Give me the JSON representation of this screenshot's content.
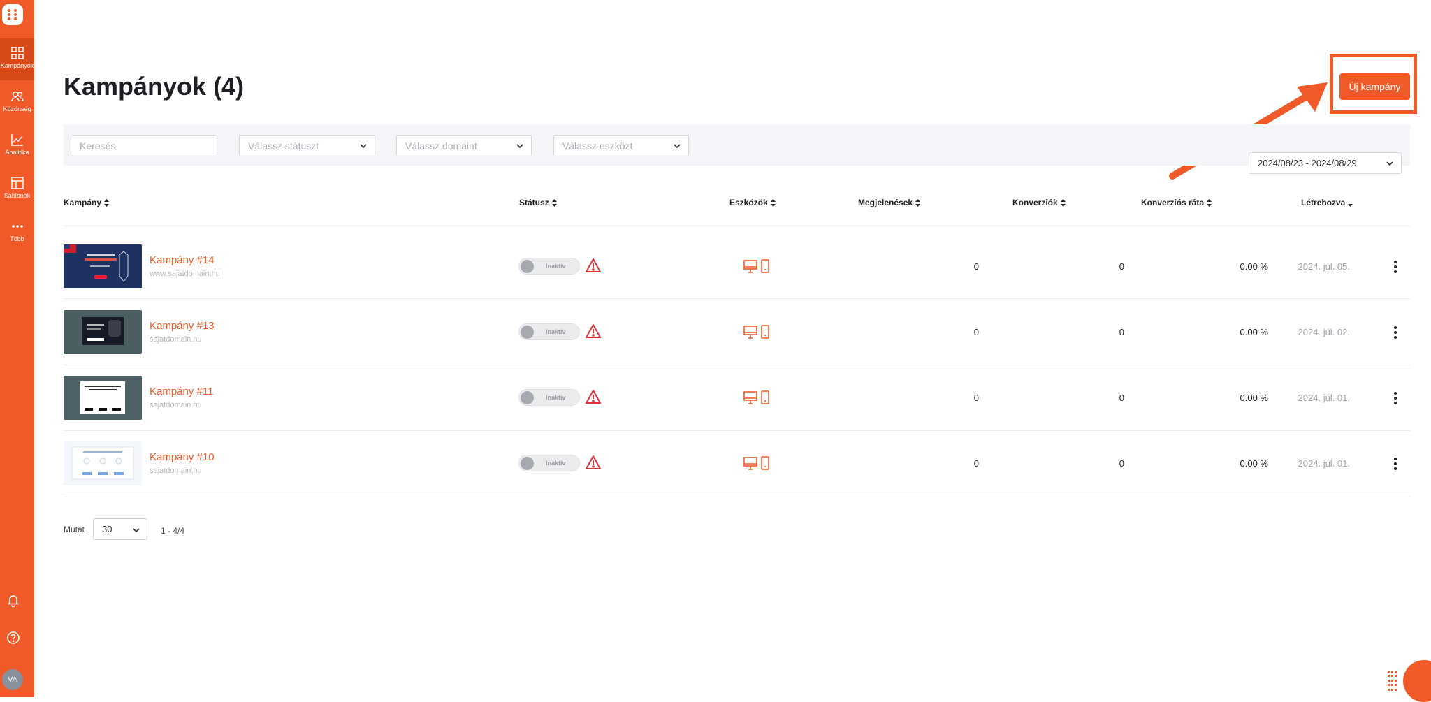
{
  "sidebar": {
    "items": [
      {
        "label": "Kampányok",
        "icon": "grid-icon",
        "active": true
      },
      {
        "label": "Közönség",
        "icon": "users-icon",
        "active": false
      },
      {
        "label": "Analitika",
        "icon": "chart-icon",
        "active": false
      },
      {
        "label": "Sablonok",
        "icon": "template-icon",
        "active": false
      },
      {
        "label": "Több",
        "icon": "more-icon",
        "active": false
      }
    ],
    "avatar_initials": "VA"
  },
  "page": {
    "title": "Kampányok (4)",
    "new_button": "Új kampány"
  },
  "filters": {
    "search_placeholder": "Keresés",
    "status_placeholder": "Válassz státuszt",
    "domain_placeholder": "Válassz domaint",
    "device_placeholder": "Válassz eszközt",
    "date_range": "2024/08/23 - 2024/08/29"
  },
  "table": {
    "headers": [
      "Kampány",
      "Státusz",
      "Eszközök",
      "Megjelenések",
      "Konverziók",
      "Konverziós ráta",
      "Létrehozva"
    ],
    "rows": [
      {
        "name": "Kampány #14",
        "domain": "www.sajatdomain.hu",
        "status": "Inaktív",
        "impressions": "0",
        "conversions": "0",
        "rate": "0.00 %",
        "created": "2024. júl. 05."
      },
      {
        "name": "Kampány #13",
        "domain": "sajatdomain.hu",
        "status": "Inaktív",
        "impressions": "0",
        "conversions": "0",
        "rate": "0.00 %",
        "created": "2024. júl. 02."
      },
      {
        "name": "Kampány #11",
        "domain": "sajatdomain.hu",
        "status": "Inaktív",
        "impressions": "0",
        "conversions": "0",
        "rate": "0.00 %",
        "created": "2024. júl. 01."
      },
      {
        "name": "Kampány #10",
        "domain": "sajatdomain.hu",
        "status": "Inaktív",
        "impressions": "0",
        "conversions": "0",
        "rate": "0.00 %",
        "created": "2024. júl. 01."
      }
    ]
  },
  "pagination": {
    "show_label": "Mutat",
    "per_page": "30",
    "range": "1 - 4/4"
  },
  "colors": {
    "accent": "#f05a28",
    "warning": "#e0303a"
  }
}
